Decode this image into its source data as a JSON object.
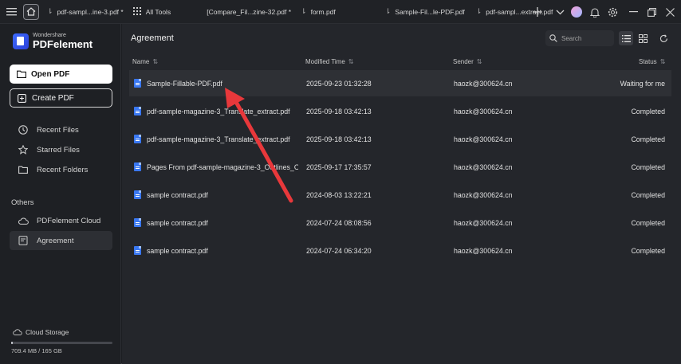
{
  "tabbar": {
    "tabs": [
      {
        "label": "pdf-sampl...ine-3.pdf *"
      },
      {
        "label": "All Tools"
      },
      {
        "label": "[Compare_Fil...zine-32.pdf *"
      },
      {
        "label": "form.pdf"
      },
      {
        "label": "Sample-Fil...le-PDF.pdf"
      },
      {
        "label": "pdf-sampl...extract.pdf"
      }
    ]
  },
  "sidebar": {
    "brand_small": "Wondershare",
    "brand_big": "PDFelement",
    "open_pdf": "Open PDF",
    "create_pdf": "Create PDF",
    "items": [
      {
        "label": "Recent Files"
      },
      {
        "label": "Starred Files"
      },
      {
        "label": "Recent Folders"
      }
    ],
    "others_title": "Others",
    "others": [
      {
        "label": "PDFelement Cloud"
      },
      {
        "label": "Agreement"
      }
    ],
    "cloud_storage": "Cloud Storage",
    "storage_used_fraction": 0.0043,
    "storage_text": "709.4 MB / 165 GB"
  },
  "main": {
    "title": "Agreement",
    "search_placeholder": "Search",
    "columns": {
      "name": "Name",
      "modified": "Modified Time",
      "sender": "Sender",
      "status": "Status"
    },
    "rows": [
      {
        "name": "Sample-Fillable-PDF.pdf",
        "modified": "2025-09-23 01:32:28",
        "sender": "haozk@300624.cn",
        "status": "Waiting for me"
      },
      {
        "name": "pdf-sample-magazine-3_Translate_extract.pdf",
        "modified": "2025-09-18 03:42:13",
        "sender": "haozk@300624.cn",
        "status": "Completed"
      },
      {
        "name": "pdf-sample-magazine-3_Translate_extract.pdf",
        "modified": "2025-09-18 03:42:13",
        "sender": "haozk@300624.cn",
        "status": "Completed"
      },
      {
        "name": "Pages From pdf-sample-magazine-3_Outlines_Outl",
        "modified": "2025-09-17 17:35:57",
        "sender": "haozk@300624.cn",
        "status": "Completed"
      },
      {
        "name": "sample contract.pdf",
        "modified": "2024-08-03 13:22:21",
        "sender": "haozk@300624.cn",
        "status": "Completed"
      },
      {
        "name": "sample contract.pdf",
        "modified": "2024-07-24 08:08:56",
        "sender": "haozk@300624.cn",
        "status": "Completed"
      },
      {
        "name": "sample contract.pdf",
        "modified": "2024-07-24 06:34:20",
        "sender": "haozk@300624.cn",
        "status": "Completed"
      }
    ]
  },
  "colors": {
    "annotation_arrow": "#e8383b",
    "file_icon": "#3a78f2"
  }
}
